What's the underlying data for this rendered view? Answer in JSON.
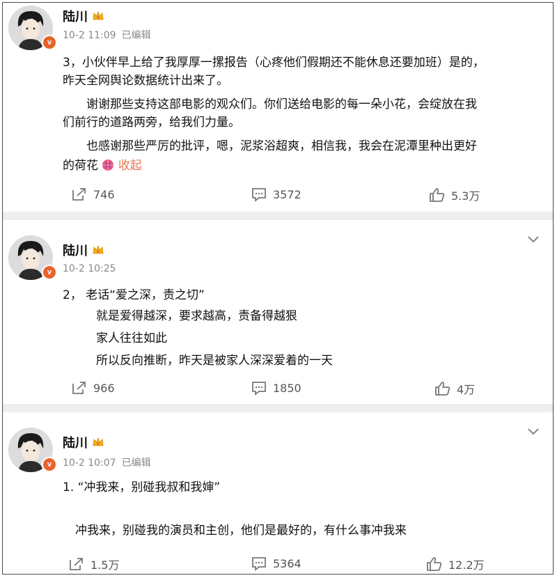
{
  "colors": {
    "accent": "#eb7350",
    "separator": "#eeeeee",
    "meta": "#888888",
    "badge": "#e8632a"
  },
  "posts": [
    {
      "author": "陆川",
      "time": "10-2 11:09",
      "edited": "已编辑",
      "lines": [
        "3，小伙伴早上给了我厚厚一摞报告（心疼他们假期还不能休息还要加班）是的，",
        "昨天全网舆论数据统计出来了。",
        "谢谢那些支持这部电影的观众们。你们送给电影的每一朵小花，会绽放在我",
        "们前行的道路两旁，给我们力量。",
        "也感谢那些严厉的批评，嗯，泥浆浴超爽，相信我，我会在泥潭里种出更好",
        "的荷花"
      ],
      "collapse": "收起",
      "reposts": "746",
      "comments": "3572",
      "likes": "5.3万"
    },
    {
      "author": "陆川",
      "time": "10-2 10:25",
      "edited": "",
      "lines": [
        "2， 老话“爱之深，责之切”",
        "就是爱得越深，要求越高，责备得越狠",
        "家人往往如此",
        "所以反向推断，昨天是被家人深深爱着的一天"
      ],
      "reposts": "966",
      "comments": "1850",
      "likes": "4万"
    },
    {
      "author": "陆川",
      "time": "10-2 10:07",
      "edited": "已编辑",
      "lines": [
        "1. “冲我来，别碰我叔和我婶”",
        "冲我来，别碰我的演员和主创，他们是最好的，有什么事冲我来"
      ],
      "reposts": "1.5万",
      "comments": "5364",
      "likes": "12.2万"
    }
  ]
}
